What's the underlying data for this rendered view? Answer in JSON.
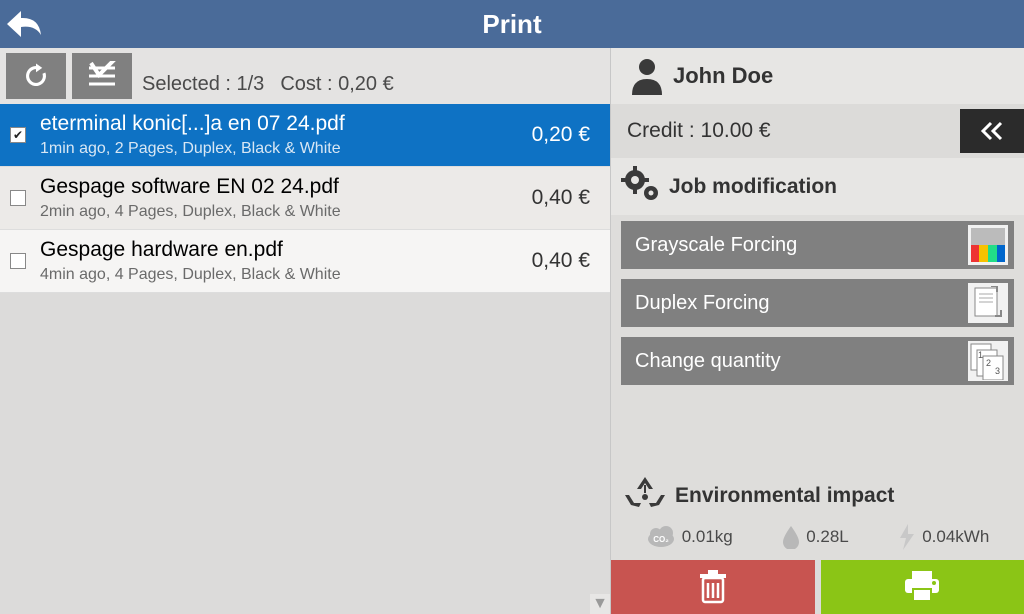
{
  "header": {
    "title": "Print"
  },
  "toolbar": {
    "selected_label": "Selected : 1/3",
    "cost_label": "Cost : 0,20 €"
  },
  "jobs": [
    {
      "name": "eterminal konic[...]a en 07 24.pdf",
      "meta": "1min ago, 2 Pages, Duplex, Black & White",
      "price": "0,20 €",
      "checked": true,
      "selected": true
    },
    {
      "name": "Gespage software EN 02 24.pdf",
      "meta": "2min ago, 4 Pages, Duplex, Black & White",
      "price": "0,40 €",
      "checked": false,
      "selected": false
    },
    {
      "name": "Gespage hardware en.pdf",
      "meta": "4min ago, 4 Pages, Duplex, Black & White",
      "price": "0,40 €",
      "checked": false,
      "selected": false
    }
  ],
  "user": {
    "name": "John Doe",
    "credit_label": "Credit : 10.00 €"
  },
  "job_mod": {
    "heading": "Job modification",
    "buttons": [
      {
        "label": "Grayscale Forcing",
        "icon": "color-swatch"
      },
      {
        "label": "Duplex Forcing",
        "icon": "duplex-page"
      },
      {
        "label": "Change quantity",
        "icon": "page-count"
      }
    ]
  },
  "env": {
    "heading": "Environmental impact",
    "co2": "0.01kg",
    "water": "0.28L",
    "power": "0.04kWh"
  },
  "colors": {
    "header": "#4a6b99",
    "selected_row": "#0e72c4",
    "delete": "#c85450",
    "print": "#8bc516"
  }
}
